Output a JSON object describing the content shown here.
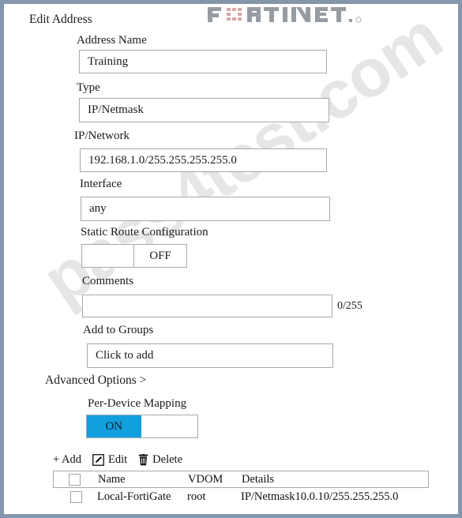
{
  "window": {
    "border_color": "#8496ac",
    "background": "#ffffff"
  },
  "brand": {
    "name": "FORTINET",
    "logo_gray": "#7b8189",
    "logo_accent": "#d89a9a"
  },
  "watermark": {
    "text": "pass4test.com"
  },
  "form": {
    "title": "Edit Address",
    "fields": {
      "address_name": {
        "label": "Address Name",
        "value": "Training"
      },
      "type": {
        "label": "Type",
        "value": "IP/Netmask"
      },
      "ip_network": {
        "label": "IP/Network",
        "value": "192.168.1.0/255.255.255.255.0"
      },
      "interface": {
        "label": "Interface",
        "value": "any"
      },
      "static_route_configuration": {
        "label": "Static Route Configuration",
        "state": "OFF",
        "on_label": "",
        "off_label": "OFF"
      },
      "comments": {
        "label": "Comments",
        "value": "",
        "counter": "0/255"
      },
      "add_to_groups": {
        "label": "Add to Groups",
        "placeholder": "Click to add"
      },
      "per_device_mapping": {
        "label": "Per-Device Mapping",
        "state": "ON",
        "on_label": "ON",
        "off_label": "",
        "on_color": "#119fdd"
      }
    },
    "advanced_options": "Advanced  Options >"
  },
  "toolbar": {
    "add_label": "+ Add",
    "edit_label": "Edit",
    "delete_label": "Delete"
  },
  "table": {
    "columns": {
      "name": "Name",
      "vdom": "VDOM",
      "details": "Details"
    },
    "rows": [
      {
        "name": "Local-FortiGate",
        "vdom": "root",
        "details": "IP/Netmask10.0.10/255.255.255.0"
      }
    ]
  }
}
